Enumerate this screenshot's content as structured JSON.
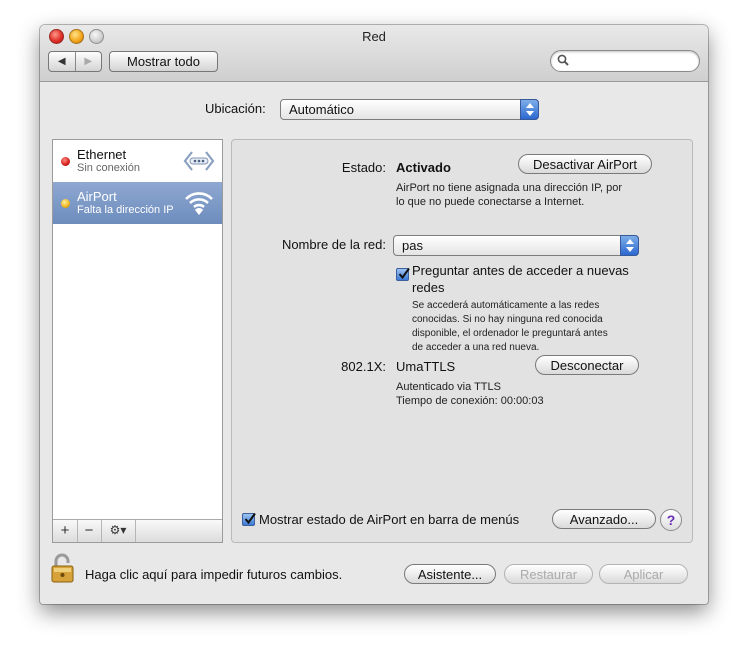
{
  "window": {
    "title": "Red"
  },
  "toolbar": {
    "back_label": "◀",
    "forward_label": "▶",
    "show_all_label": "Mostrar todo",
    "search_value": ""
  },
  "location": {
    "label": "Ubicación:",
    "value": "Automático"
  },
  "services": [
    {
      "name": "Ethernet",
      "status": "Sin conexión",
      "status_color": "#d11a1a",
      "icon": "ethernet-arrows-icon",
      "selected": false
    },
    {
      "name": "AirPort",
      "status": "Falta la dirección IP",
      "status_color": "#f2b41c",
      "icon": "wifi-icon",
      "selected": true
    }
  ],
  "sidebar_actions": {
    "add": "+",
    "remove": "−",
    "gear": "⚙▾"
  },
  "status": {
    "label": "Estado:",
    "value": "Activado",
    "toggle_button": "Desactivar AirPort",
    "description_line1": "AirPort no tiene asignada una dirección IP, por",
    "description_line2": "lo que no puede conectarse a Internet."
  },
  "network_name": {
    "label": "Nombre de la red:",
    "value": "pas"
  },
  "ask_networks": {
    "checked": true,
    "label_line1": "Preguntar antes de acceder a nuevas",
    "label_line2": "redes",
    "note_line1": "Se accederá automáticamente a las redes",
    "note_line2": "conocidas. Si no hay ninguna red conocida",
    "note_line3": "disponible, el ordenador le preguntará antes",
    "note_line4": "de acceder a una red nueva."
  },
  "dot1x": {
    "label": "802.1X:",
    "value": "UmaTTLS",
    "button": "Desconectar",
    "auth": "Autenticado via TTLS",
    "time": "Tiempo de conexión: 00:00:03"
  },
  "menu_status": {
    "checked": true,
    "label": "Mostrar estado de AirPort en barra de menús"
  },
  "advanced_button": "Avanzado...",
  "help_label": "?",
  "footer": {
    "lock_text": "Haga clic aquí para impedir futuros cambios.",
    "assistant": "Asistente...",
    "revert": "Restaurar",
    "apply": "Aplicar"
  },
  "colors": {
    "selection": "#7f9bc9",
    "accent_blue": "#2b68d0"
  }
}
